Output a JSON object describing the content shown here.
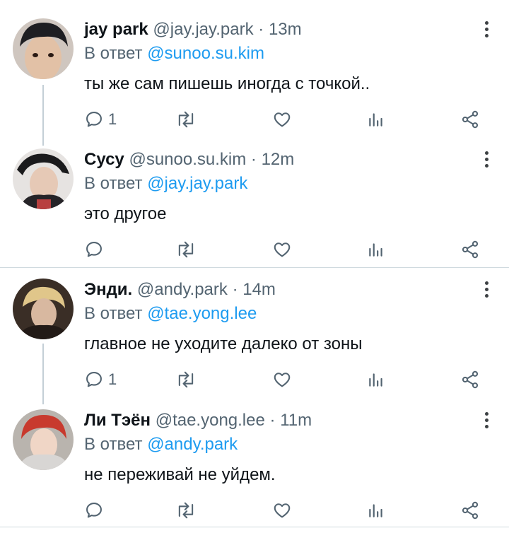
{
  "tweets": [
    {
      "name": "jay park",
      "handle": "@jay.jay.park",
      "time": "13m",
      "reply_prefix": "В ответ",
      "reply_to": "@sunoo.su.kim",
      "text": "ты же сам пишешь иногда с точкой..",
      "reply_count": "1"
    },
    {
      "name": "Сусу",
      "handle": "@sunoo.su.kim",
      "time": "12m",
      "reply_prefix": "В ответ",
      "reply_to": "@jay.jay.park",
      "text": "это другое",
      "reply_count": ""
    },
    {
      "name": "Энди.",
      "handle": "@andy.park",
      "time": "14m",
      "reply_prefix": "В ответ",
      "reply_to": "@tae.yong.lee",
      "text": "главное не уходите далеко от зоны",
      "reply_count": "1"
    },
    {
      "name": "Ли Тэён",
      "handle": "@tae.yong.lee",
      "time": "11m",
      "reply_prefix": "В ответ",
      "reply_to": "@andy.park",
      "text": "не переживай не уйдем.",
      "reply_count": ""
    }
  ],
  "separator": "·",
  "colors": {
    "accent": "#1d9bf0",
    "muted": "#536471",
    "text": "#0f1419"
  },
  "icons": [
    "reply-icon",
    "retweet-icon",
    "like-icon",
    "views-icon",
    "share-icon",
    "more-icon"
  ]
}
